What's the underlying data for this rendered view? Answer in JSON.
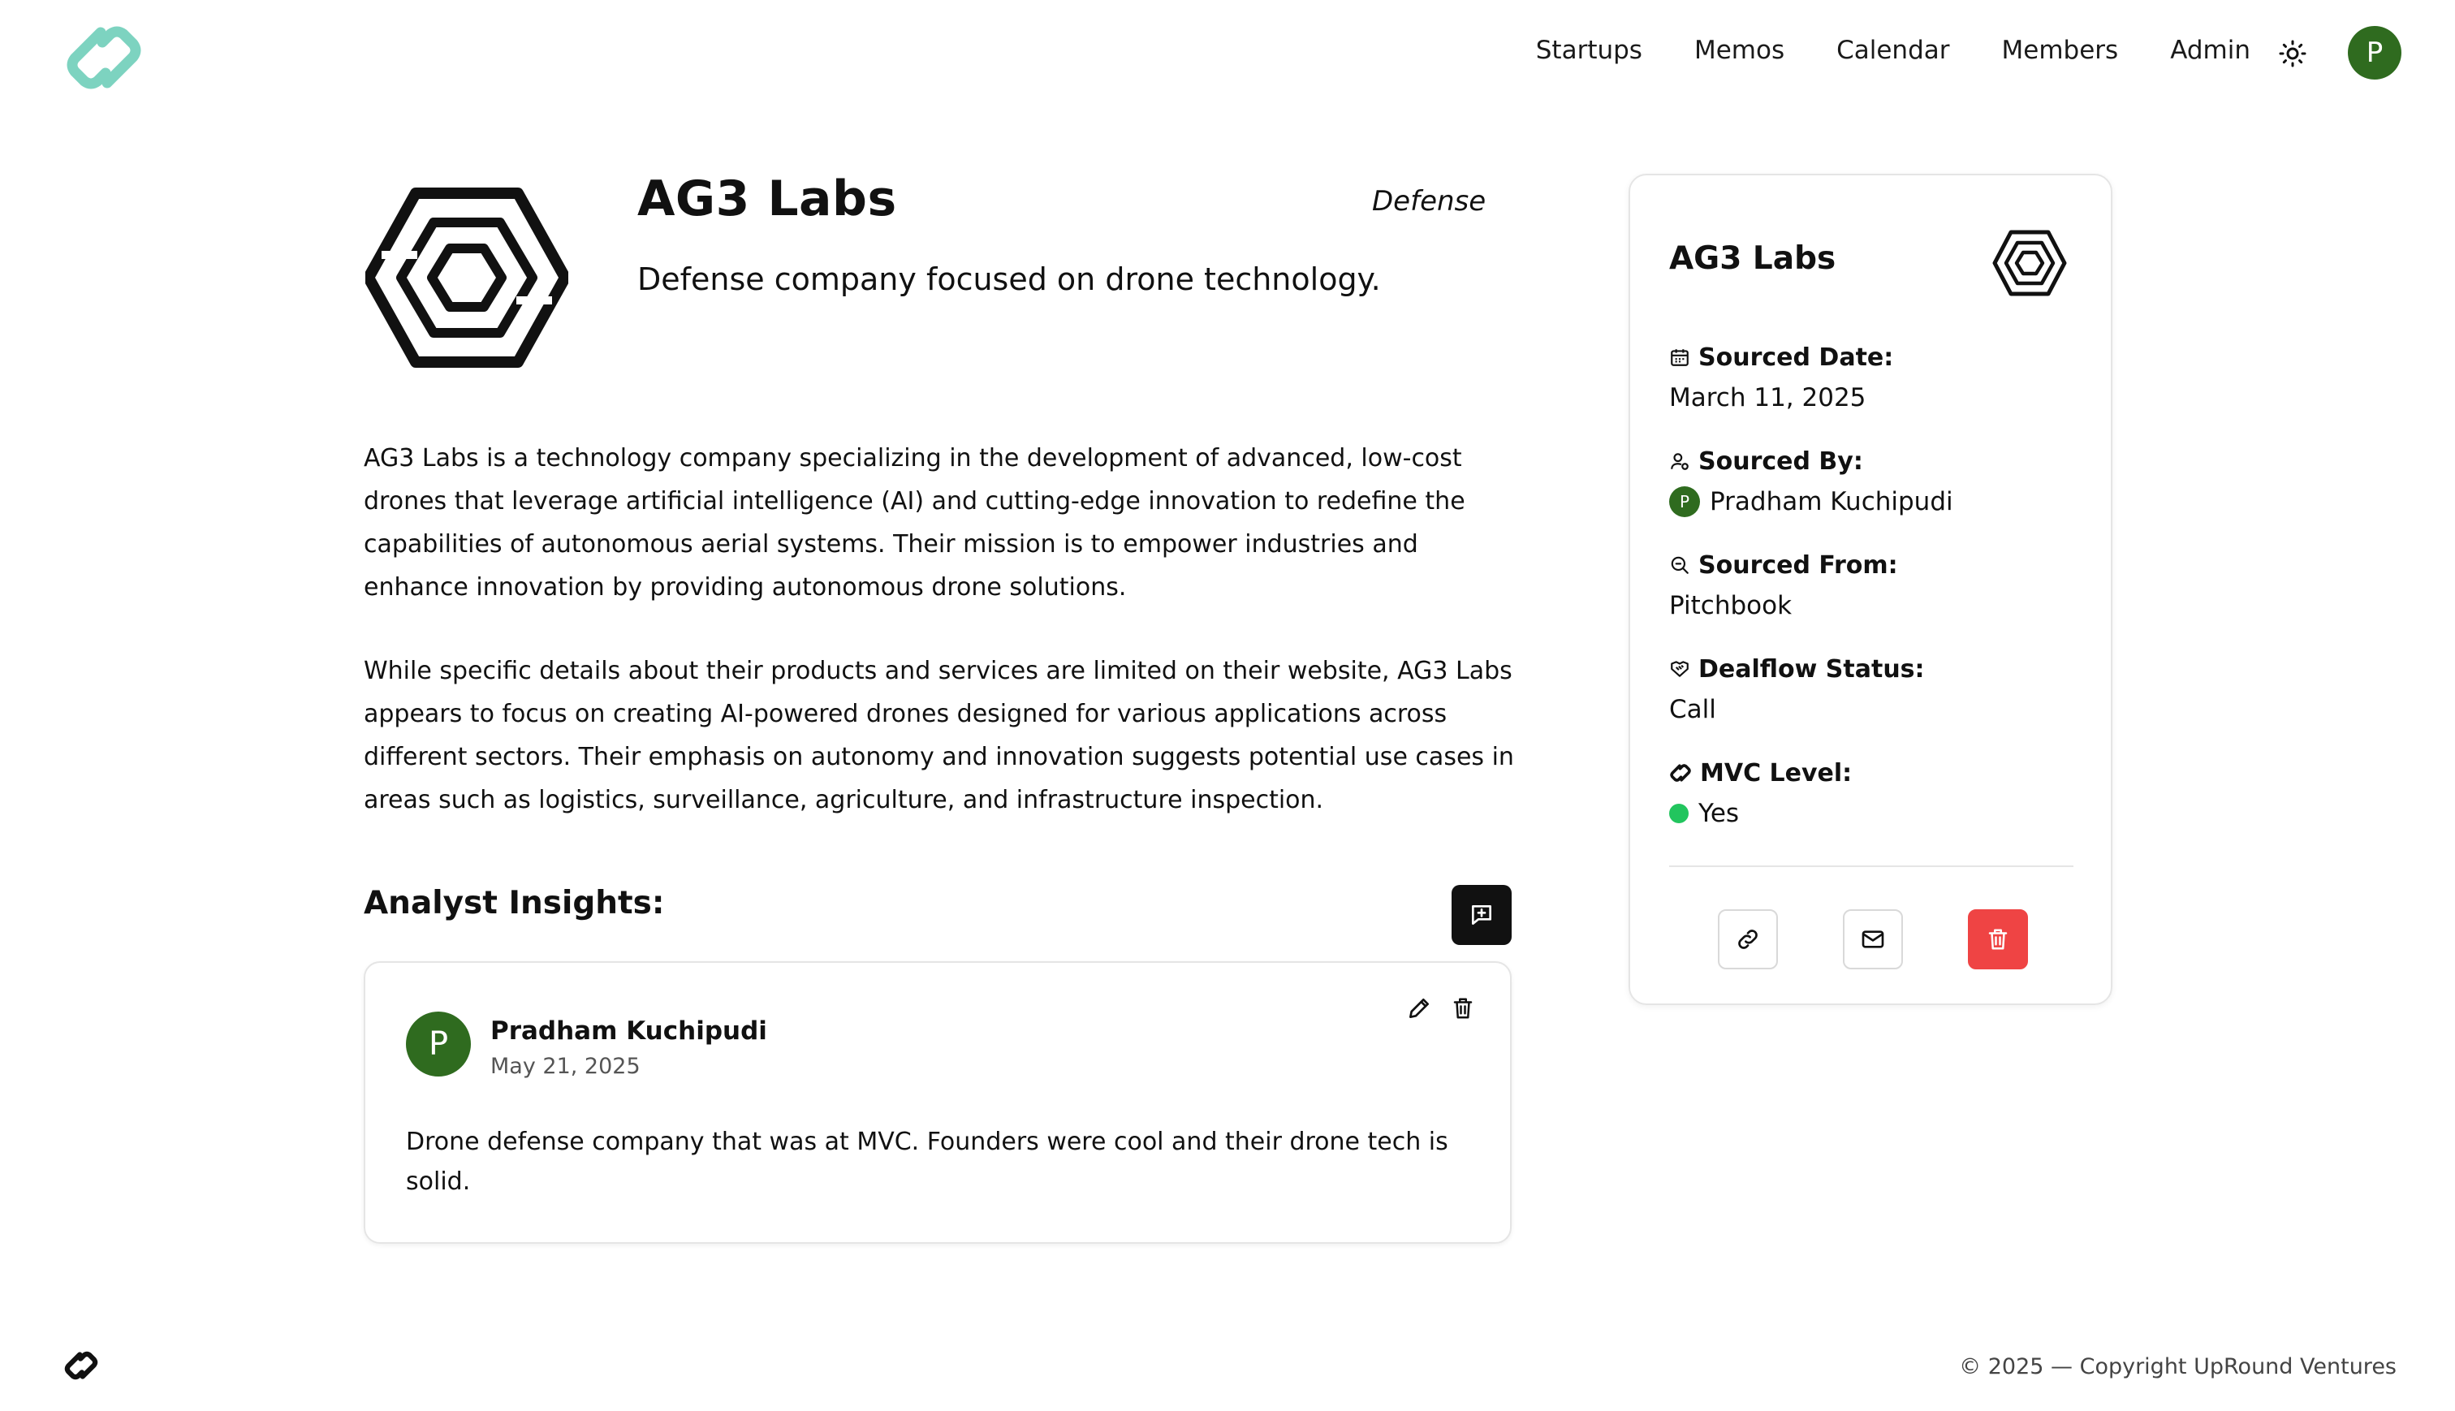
{
  "app": {
    "brand_color": "#7dd3c0",
    "accent_green": "#2f6b1f"
  },
  "nav": {
    "items": [
      "Startups",
      "Memos",
      "Calendar",
      "Members",
      "Admin"
    ],
    "theme_icon": "sun-icon",
    "user_initial": "P"
  },
  "company": {
    "name": "AG3 Labs",
    "sector": "Defense",
    "tagline": "Defense company focused on drone technology.",
    "description": [
      "AG3 Labs is a technology company specializing in the development of advanced, low-cost drones that leverage artificial intelligence (AI) and cutting-edge innovation to redefine the capabilities of autonomous aerial systems. Their mission is to empower industries and enhance innovation by providing autonomous drone solutions.",
      "While specific details about their products and services are limited on their website, AG3 Labs appears to focus on creating AI-powered drones designed for various applications across different sectors. Their emphasis on autonomy and innovation suggests potential use cases in areas such as logistics, surveillance, agriculture, and infrastructure inspection."
    ]
  },
  "insights": {
    "title": "Analyst Insights:",
    "items": [
      {
        "initial": "P",
        "author": "Pradham Kuchipudi",
        "date": "May 21, 2025",
        "text": "Drone defense company that was at MVC. Founders were cool and their drone tech is solid."
      }
    ]
  },
  "sidebar": {
    "name": "AG3 Labs",
    "fields": [
      {
        "label": "Sourced Date:",
        "value": "March 11, 2025",
        "icon": "calendar-icon"
      },
      {
        "label": "Sourced By:",
        "value": "Pradham Kuchipudi",
        "icon": "user-icon",
        "initial": "P"
      },
      {
        "label": "Sourced From:",
        "value": "Pitchbook",
        "icon": "search-icon"
      },
      {
        "label": "Dealflow Status:",
        "value": "Call",
        "icon": "handshake-icon"
      },
      {
        "label": "MVC Level:",
        "value": "Yes",
        "icon": "link-logo-icon",
        "status_color": "#22c55e"
      }
    ]
  },
  "footer": {
    "copyright": "© 2025 — Copyright UpRound Ventures"
  }
}
